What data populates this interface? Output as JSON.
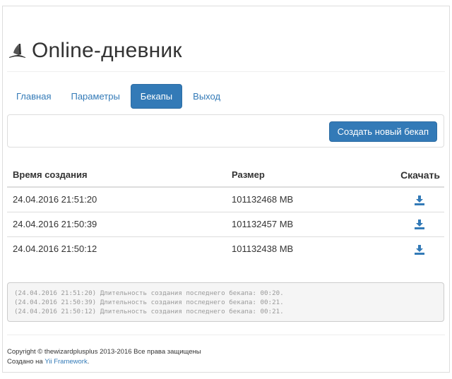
{
  "header": {
    "title": "Online-дневник",
    "icon": "quill-pen-icon"
  },
  "nav": {
    "items": [
      {
        "label": "Главная"
      },
      {
        "label": "Параметры"
      },
      {
        "label": "Бекапы"
      },
      {
        "label": "Выход"
      }
    ],
    "active": "Бекапы"
  },
  "panel": {
    "create_button": "Создать новый бекап"
  },
  "table": {
    "columns": {
      "time": "Время создания",
      "size": "Размер",
      "download": "Скачать"
    },
    "rows": [
      {
        "time": "24.04.2016 21:51:20",
        "size": "101132468 MB",
        "icon": "download-icon"
      },
      {
        "time": "24.04.2016 21:50:39",
        "size": "101132457 MB",
        "icon": "download-icon"
      },
      {
        "time": "24.04.2016 21:50:12",
        "size": "101132438 MB",
        "icon": "download-icon"
      }
    ]
  },
  "log": {
    "lines": [
      "(24.04.2016 21:51:20) Длительность создания последнего бекапа: 00:20.",
      "(24.04.2016 21:50:39) Длительность создания последнего бекапа: 00:21.",
      "(24.04.2016 21:50:12) Длительность создания последнего бекапа: 00:21."
    ]
  },
  "footer": {
    "copyright": "Copyright © thewizardplusplus 2013-2016 Все права защищены",
    "made_with_prefix": "Создано на ",
    "framework_link": "Yii Framework",
    "made_with_suffix": "."
  },
  "colors": {
    "accent": "#337ab7",
    "border": "#dddddd",
    "log_bg": "#f5f5f5"
  }
}
